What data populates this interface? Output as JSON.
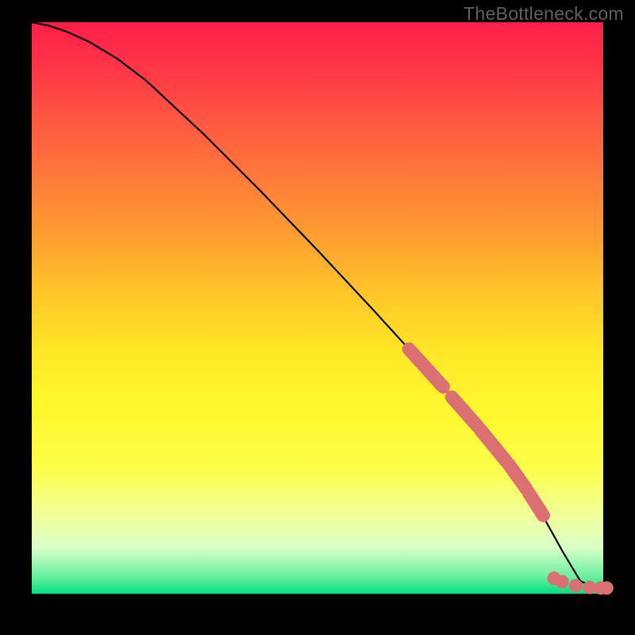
{
  "watermark": "TheBottleneck.com",
  "chart_data": {
    "type": "line",
    "title": "",
    "xlabel": "",
    "ylabel": "",
    "xlim": [
      0,
      100
    ],
    "ylim": [
      0,
      100
    ],
    "curve": {
      "x": [
        0,
        3,
        6,
        10,
        15,
        20,
        30,
        40,
        50,
        60,
        70,
        80,
        88,
        93,
        96,
        100
      ],
      "y": [
        100,
        99.4,
        98.4,
        96.6,
        93.6,
        89.8,
        80.5,
        70.5,
        60.1,
        49.4,
        38.4,
        26.9,
        16.2,
        7.2,
        2.2,
        0.5
      ]
    },
    "highlight_segments": [
      {
        "x": [
          66,
          72
        ],
        "y": [
          42.8,
          36.2
        ]
      },
      {
        "x": [
          73.5,
          78
        ],
        "y": [
          34.4,
          29.3
        ]
      },
      {
        "x": [
          78.5,
          83
        ],
        "y": [
          28.7,
          23.2
        ]
      },
      {
        "x": [
          83.5,
          86.5
        ],
        "y": [
          22.6,
          18.4
        ]
      },
      {
        "x": [
          87,
          89.5
        ],
        "y": [
          17.6,
          13.7
        ]
      }
    ],
    "highlight_points": [
      {
        "x": 91.4,
        "y": 2.7
      },
      {
        "x": 92.8,
        "y": 2.1
      },
      {
        "x": 95.2,
        "y": 1.4
      },
      {
        "x": 97.6,
        "y": 1.1
      },
      {
        "x": 99.6,
        "y": 1.0
      },
      {
        "x": 100.6,
        "y": 1.0
      }
    ],
    "gradient_stops": [
      {
        "pct": 0,
        "color": "#ff1e4a"
      },
      {
        "pct": 50,
        "color": "#ffe826"
      },
      {
        "pct": 97,
        "color": "#68f0a0"
      },
      {
        "pct": 100,
        "color": "#00df80"
      }
    ]
  }
}
